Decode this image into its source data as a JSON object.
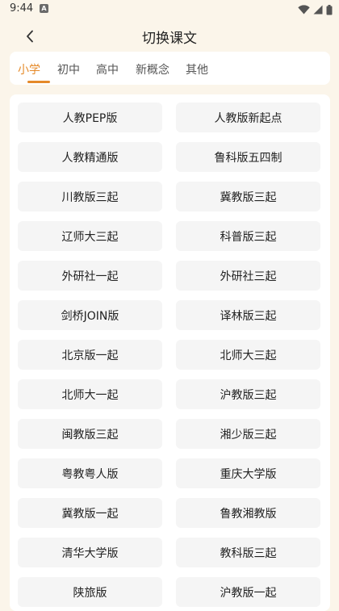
{
  "status": {
    "time": "9:44",
    "app_icon_letter": "A"
  },
  "header": {
    "title": "切换课文"
  },
  "tabs": [
    {
      "label": "小学",
      "active": true
    },
    {
      "label": "初中",
      "active": false
    },
    {
      "label": "高中",
      "active": false
    },
    {
      "label": "新概念",
      "active": false
    },
    {
      "label": "其他",
      "active": false
    }
  ],
  "textbooks": [
    "人教PEP版",
    "人教版新起点",
    "人教精通版",
    "鲁科版五四制",
    "川教版三起",
    "冀教版三起",
    "辽师大三起",
    "科普版三起",
    "外研社一起",
    "外研社三起",
    "剑桥JOIN版",
    "译林版三起",
    "北京版一起",
    "北师大三起",
    "北师大一起",
    "沪教版三起",
    "闽教版三起",
    "湘少版三起",
    "粤教粤人版",
    "重庆大学版",
    "冀教版一起",
    "鲁教湘教版",
    "清华大学版",
    "教科版三起",
    "陕旅版",
    "沪教版一起"
  ],
  "colors": {
    "accent": "#E58A2A",
    "background": "#FBF5EA",
    "item_background": "#F5F5F5"
  }
}
